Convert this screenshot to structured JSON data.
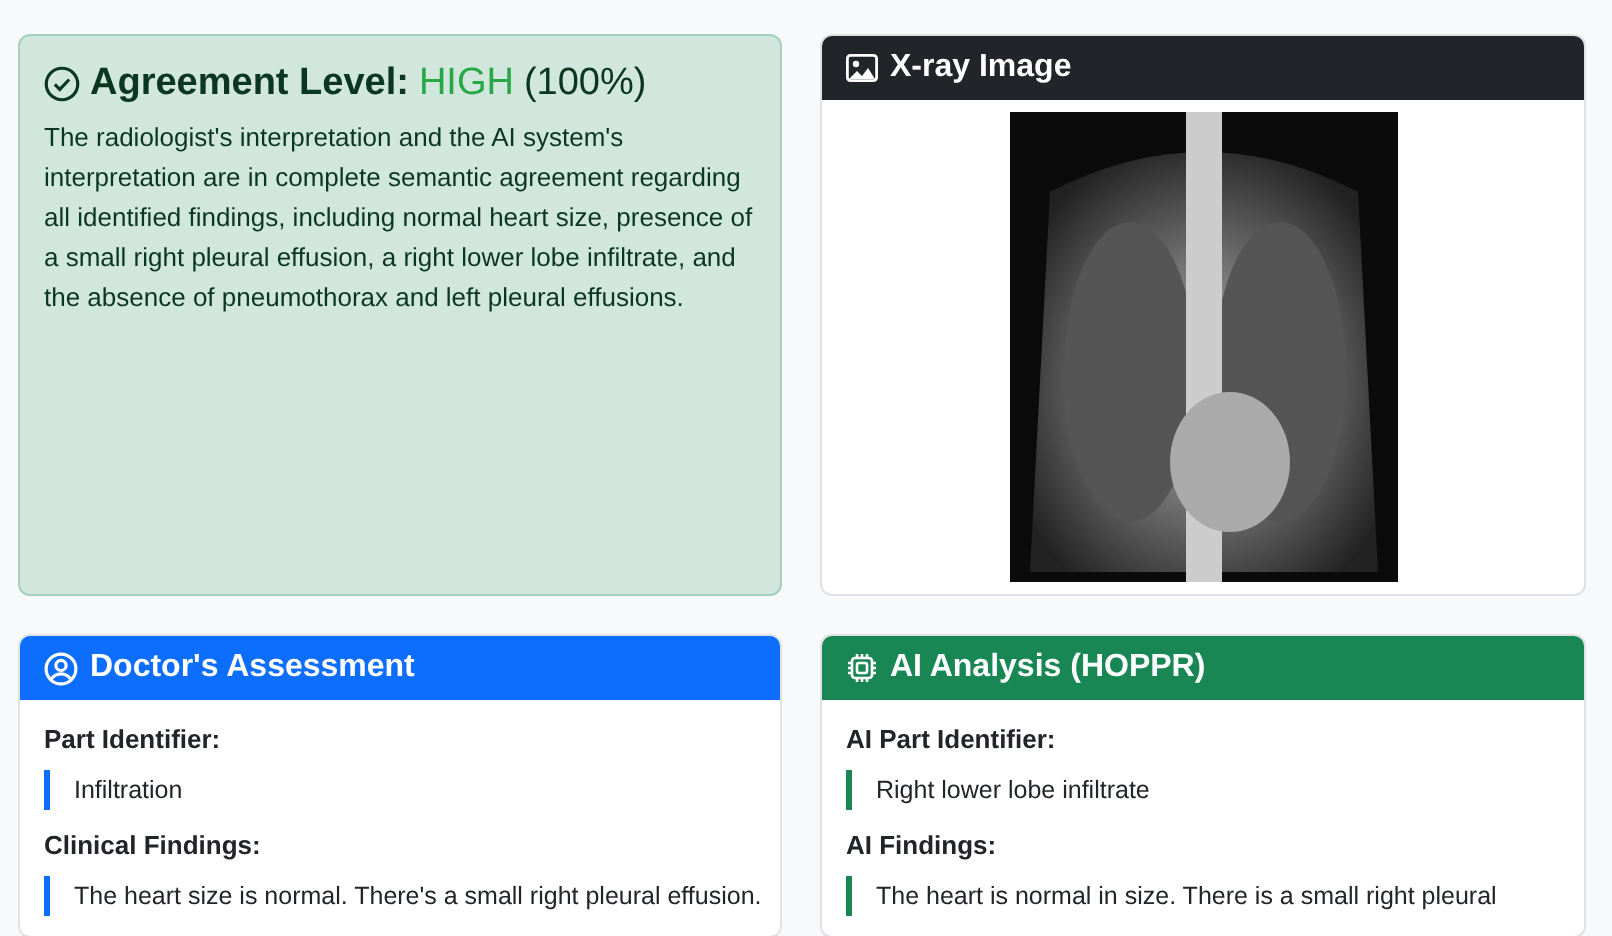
{
  "agreement": {
    "label": "Agreement Level:",
    "level": "HIGH",
    "percent": "(100%)",
    "summary": "The radiologist's interpretation and the AI system's interpretation are in complete semantic agreement regarding all identified findings, including normal heart size, presence of a small right pleural effusion, a right lower lobe infiltrate, and the absence of pneumothorax and left pleural effusions."
  },
  "xray": {
    "title": "X-ray Image"
  },
  "panels": [
    {
      "kind": "doctor",
      "title": "Doctor's Assessment",
      "sections": [
        {
          "label": "Part Identifier:",
          "text": "Infiltration"
        },
        {
          "label": "Clinical Findings:",
          "text": "The heart size is normal. There's a small right pleural effusion."
        }
      ]
    },
    {
      "kind": "ai",
      "title": "AI Analysis (HOPPR)",
      "sections": [
        {
          "label": "AI Part Identifier:",
          "text": "Right lower lobe infiltrate"
        },
        {
          "label": "AI Findings:",
          "text": "The heart is normal in size. There is a small right pleural"
        }
      ]
    }
  ]
}
